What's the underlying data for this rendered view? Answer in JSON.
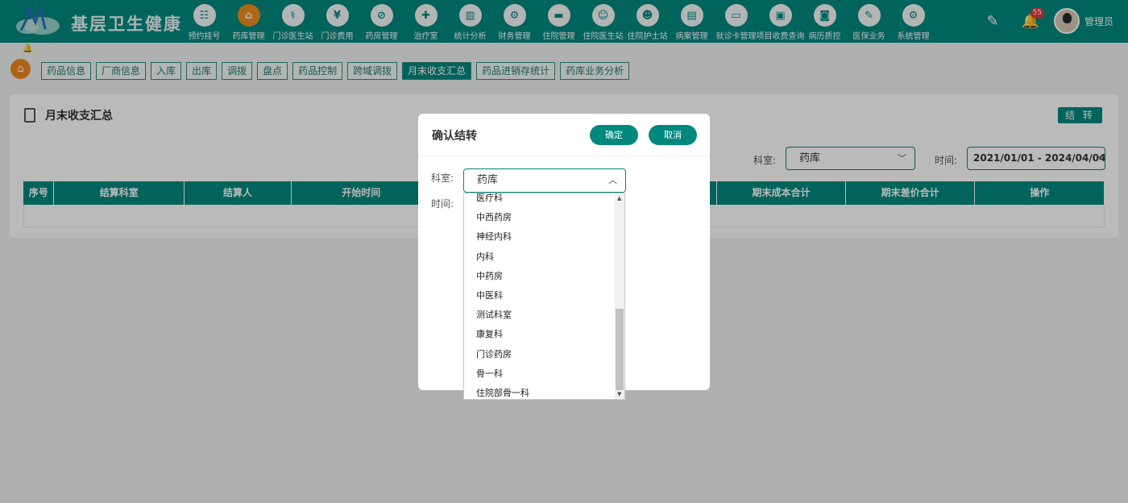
{
  "header": {
    "title": "基层卫生健康",
    "nav": [
      {
        "label": "预约挂号",
        "icon": "calendar-icon",
        "glyph": "☷"
      },
      {
        "label": "药库管理",
        "icon": "home-icon",
        "glyph": "⌂",
        "active": true
      },
      {
        "label": "门诊医生站",
        "icon": "stethoscope-icon",
        "glyph": "⚕"
      },
      {
        "label": "门诊费用",
        "icon": "yen-icon",
        "glyph": "¥"
      },
      {
        "label": "药房管理",
        "icon": "pill-icon",
        "glyph": "⊘"
      },
      {
        "label": "治疗室",
        "icon": "nurse-icon",
        "glyph": "✚"
      },
      {
        "label": "统计分析",
        "icon": "chart-icon",
        "glyph": "▥"
      },
      {
        "label": "财务管理",
        "icon": "finance-gear-icon",
        "glyph": "⚙"
      },
      {
        "label": "住院管理",
        "icon": "bed-icon",
        "glyph": "▬"
      },
      {
        "label": "住院医生站",
        "icon": "doctor-icon",
        "glyph": "☺"
      },
      {
        "label": "住院护士站",
        "icon": "nurse-station-icon",
        "glyph": "☻"
      },
      {
        "label": "病案管理",
        "icon": "case-file-icon",
        "glyph": "▤"
      },
      {
        "label": "就诊卡管理",
        "icon": "card-icon",
        "glyph": "▭"
      },
      {
        "label": "项目收费查询",
        "icon": "query-icon",
        "glyph": "▣"
      },
      {
        "label": "病历质控",
        "icon": "record-icon",
        "glyph": "◙"
      },
      {
        "label": "医保业务",
        "icon": "insurance-icon",
        "glyph": "✎"
      },
      {
        "label": "系统管理",
        "icon": "settings-icon",
        "glyph": "⚙"
      }
    ],
    "notifications": "55",
    "username": "管理员"
  },
  "tabs": [
    "药品信息",
    "厂商信息",
    "入库",
    "出库",
    "调拨",
    "盘点",
    "药品控制",
    "跨域调拨",
    "月末收支汇总",
    "药品进销存统计",
    "药库业务分析"
  ],
  "active_tab": "月末收支汇总",
  "panel": {
    "title": "月末收支汇总",
    "carry_button": "结 转",
    "dept_label": "科室:",
    "dept_value": "药库",
    "time_label": "时间:",
    "time_value": "2021/01/01 - 2024/04/04"
  },
  "table": {
    "columns": [
      "序号",
      "结算科室",
      "结算人",
      "开始时间",
      "",
      "",
      "",
      "期末成本合计",
      "期末差价合计",
      "操作"
    ]
  },
  "modal": {
    "title": "确认结转",
    "ok": "确定",
    "cancel": "取消",
    "dept_label": "科室:",
    "dept_value": "药库",
    "time_label": "时间:"
  },
  "dropdown": {
    "options": [
      "医疗科",
      "中西药房",
      "神经内科",
      "内科",
      "中药房",
      "中医科",
      "测试科室",
      "康复科",
      "门诊药房",
      "骨一科",
      "住院部骨一科"
    ]
  }
}
